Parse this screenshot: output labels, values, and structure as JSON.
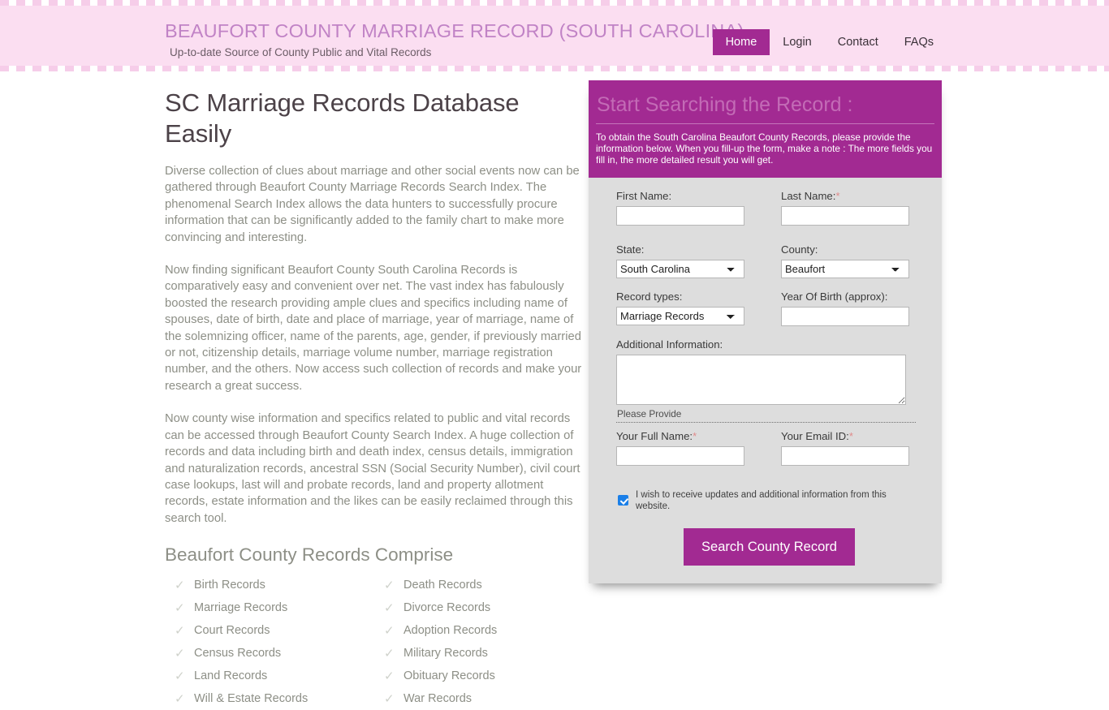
{
  "header": {
    "site_title": "BEAUFORT COUNTY MARRIAGE RECORD (SOUTH CAROLINA)",
    "tagline": "Up-to-date Source of  County Public and Vital Records",
    "nav": [
      {
        "label": "Home",
        "active": true
      },
      {
        "label": "Login",
        "active": false
      },
      {
        "label": "Contact",
        "active": false
      },
      {
        "label": "FAQs",
        "active": false
      }
    ]
  },
  "content": {
    "page_title": "SC Marriage Records Database Easily",
    "paragraphs": [
      "Diverse collection of clues about marriage and other social events now can be gathered through Beaufort County Marriage Records Search Index. The phenomenal Search Index allows the data hunters to successfully procure information that can be significantly added to the family chart to make more convincing and interesting.",
      "Now finding significant Beaufort County South Carolina Records is comparatively easy and convenient over net. The vast index has fabulously boosted the research providing ample clues and specifics including name of spouses, date of birth, date and place of marriage, year of marriage, name of the solemnizing officer, name of the parents, age, gender, if previously married or not, citizenship details, marriage volume number, marriage registration number, and the others. Now access such collection of records and make your research a great success.",
      "Now county wise information and specifics related to public and vital records can be accessed through Beaufort County Search Index. A huge collection of records and data including birth and death index, census details, immigration and naturalization records, ancestral SSN (Social Security Number), civil court case lookups, last will and probate records, land and property allotment records, estate information and the likes can be easily reclaimed through this search tool."
    ],
    "records_heading": "Beaufort County Records Comprise",
    "records": [
      "Birth Records",
      "Death Records",
      "Marriage Records",
      "Divorce Records",
      "Court Records",
      "Adoption Records",
      "Census Records",
      "Military Records",
      "Land Records",
      "Obituary Records",
      "Will & Estate Records",
      "War Records"
    ],
    "check_icon": "check-mark"
  },
  "search_form": {
    "panel_title": "Start Searching the Record :",
    "panel_description": "To obtain the South Carolina Beaufort County Records, please provide the information below. When you fill-up the form, make a note : The more fields you fill in, the more detailed result you will get.",
    "first_name_label": "First Name:",
    "first_name_value": "",
    "last_name_label": "Last Name:",
    "last_name_required": "*",
    "last_name_value": "",
    "state_label": "State:",
    "state_value": "South Carolina",
    "county_label": "County:",
    "county_value": "Beaufort",
    "record_types_label": "Record types:",
    "record_types_value": "Marriage Records",
    "year_of_birth_label": "Year Of Birth (approx):",
    "year_of_birth_value": "",
    "additional_info_label": "Additional Information:",
    "additional_info_value": "",
    "please_provide": "Please Provide",
    "full_name_label": "Your Full Name:",
    "full_name_required": "*",
    "full_name_value": "",
    "email_label": "Your Email ID:",
    "email_required": "*",
    "email_value": "",
    "consent_text": "I wish to receive updates and additional information from this website.",
    "consent_checked": true,
    "submit_label": "Search County Record"
  },
  "colors": {
    "brand_magenta": "#a22a92",
    "header_pink": "#fbdef1",
    "title_pink": "#c183c6",
    "panel_gray": "#dddddd",
    "body_text": "#8d8f86",
    "required_red": "#e08a8a",
    "checkbox_blue": "#1a7fe8"
  }
}
